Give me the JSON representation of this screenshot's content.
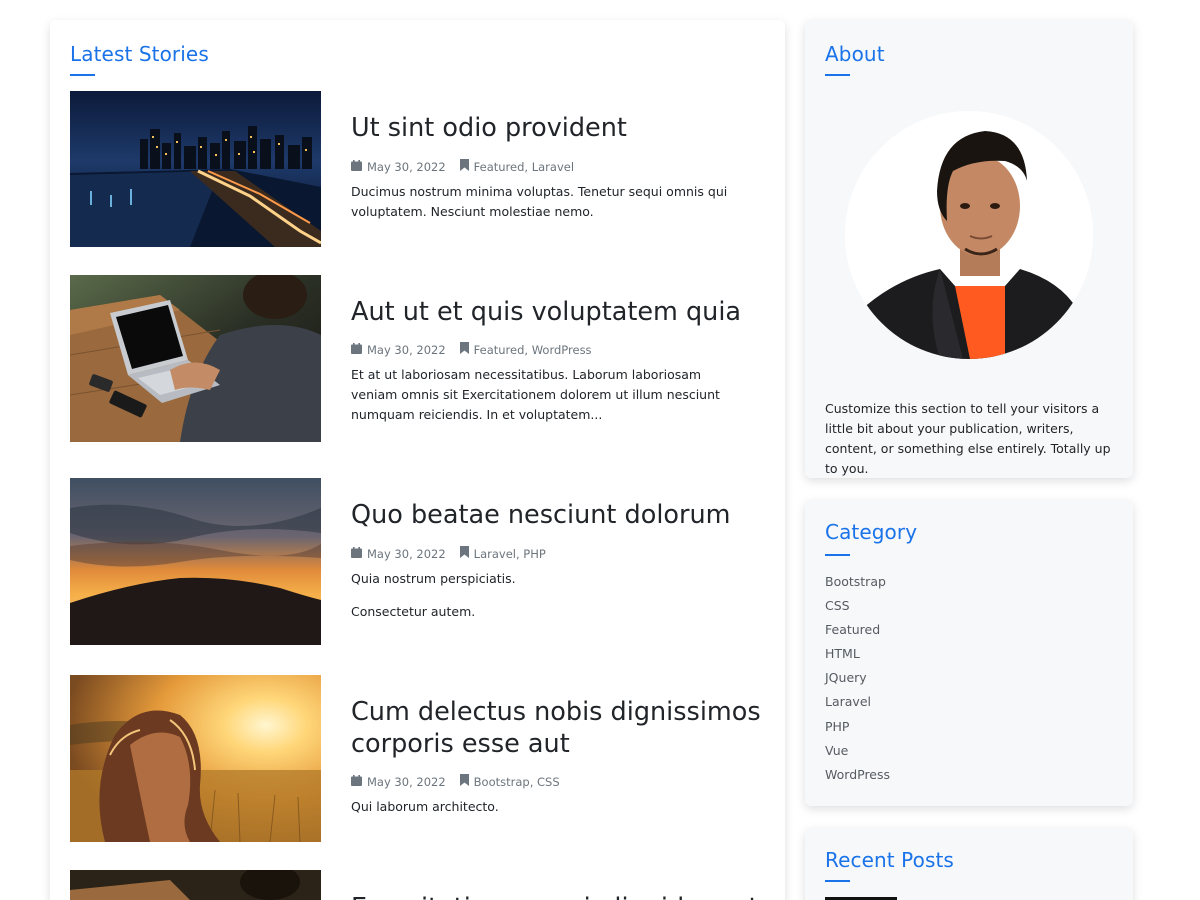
{
  "latest": {
    "title": "Latest Stories",
    "posts": [
      {
        "title": "Ut sint odio provident",
        "date": "May 30, 2022",
        "tags": "Featured, Laravel",
        "excerpt": "Ducimus nostrum minima voluptas. Tenetur sequi omnis qui voluptatem. Nesciunt molestiae nemo."
      },
      {
        "title": "Aut ut et quis voluptatem quia",
        "date": "May 30, 2022",
        "tags": "Featured, WordPress",
        "excerpt": "Et at ut laboriosam necessitatibus. Laborum laboriosam veniam omnis sit Exercitationem dolorem ut illum nesciunt numquam reiciendis. In et voluptatem..."
      },
      {
        "title": "Quo beatae nesciunt dolorum",
        "date": "May 30, 2022",
        "tags": "Laravel, PHP",
        "excerpt": "Quia nostrum perspiciatis.",
        "excerpt2": "Consectetur autem."
      },
      {
        "title": "Cum delectus nobis dignissimos corporis esse aut",
        "date": "May 30, 2022",
        "tags": "Bootstrap, CSS",
        "excerpt": "Qui laborum architecto."
      },
      {
        "title": "Exercitationem quia liquidem et"
      }
    ]
  },
  "about": {
    "title": "About",
    "text": "Customize this section to tell your visitors a little bit about your publication, writers, content, or something else entirely. Totally up to you."
  },
  "category": {
    "title": "Category",
    "items": [
      "Bootstrap",
      "CSS",
      "Featured",
      "HTML",
      "JQuery",
      "Laravel",
      "PHP",
      "Vue",
      "WordPress"
    ]
  },
  "recent": {
    "title": "Recent Posts"
  },
  "icons": {
    "date": "calendar-icon",
    "tags": "bookmark-icon"
  },
  "colors": {
    "accent": "#1a73e8",
    "text": "#212529",
    "muted": "#6c757d",
    "sidebar_bg": "#f7f8fa"
  }
}
